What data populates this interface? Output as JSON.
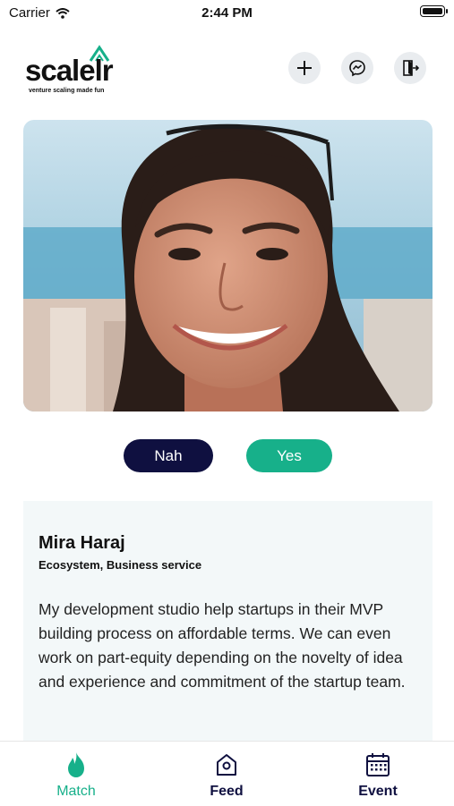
{
  "status_bar": {
    "carrier": "Carrier",
    "time": "2:44 PM",
    "battery_level": 1.0
  },
  "header": {
    "logo_text": "scalelr",
    "logo_tagline": "venture scaling made fun",
    "buttons": [
      {
        "icon": "plus-icon"
      },
      {
        "icon": "messenger-icon"
      },
      {
        "icon": "logout-icon"
      }
    ]
  },
  "actions": {
    "nah_label": "Nah",
    "yes_label": "Yes"
  },
  "profile": {
    "name": "Mira Haraj",
    "categories": "Ecosystem, Business service",
    "bio": "My development studio help startups in their MVP building process on affordable terms. We can even work on part-equity depending on the novelty of idea and experience and commitment of the startup team."
  },
  "tabs": [
    {
      "label": "Match",
      "icon": "flame-icon",
      "active": true
    },
    {
      "label": "Feed",
      "icon": "home-icon",
      "active": false
    },
    {
      "label": "Event",
      "icon": "calendar-icon",
      "active": false
    }
  ],
  "colors": {
    "accent": "#17b08a",
    "navy": "#0f1040",
    "card_bg": "#f3f8f9"
  }
}
